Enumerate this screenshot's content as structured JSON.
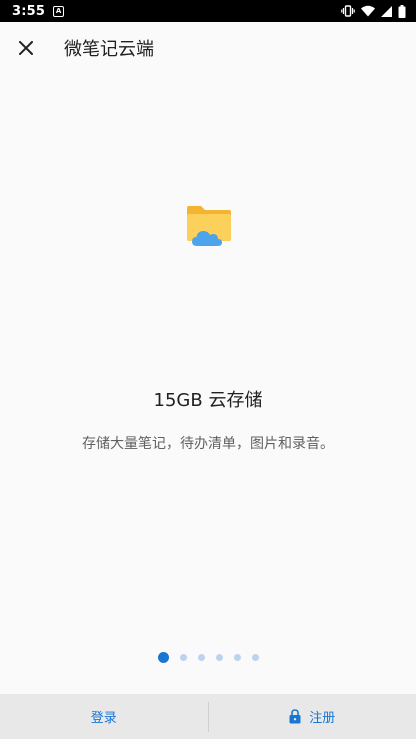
{
  "status_bar": {
    "time": "3:55",
    "notification_glyph": "A"
  },
  "app_bar": {
    "title": "微笔记云端",
    "close_icon": "close-icon"
  },
  "feature": {
    "icon": "cloud-folder-icon",
    "title": "15GB 云存储",
    "description": "存储大量笔记，待办清单，图片和录音。"
  },
  "pager": {
    "count": 6,
    "active_index": 0
  },
  "bottom_bar": {
    "login_label": "登录",
    "register_label": "注册",
    "register_icon": "lock-icon"
  },
  "colors": {
    "accent": "#1976d2",
    "dot_inactive": "#bcd3f0",
    "folder": "#f5c23b",
    "cloud": "#4da3ec",
    "bottom_bar_bg": "#e8e8e8"
  }
}
